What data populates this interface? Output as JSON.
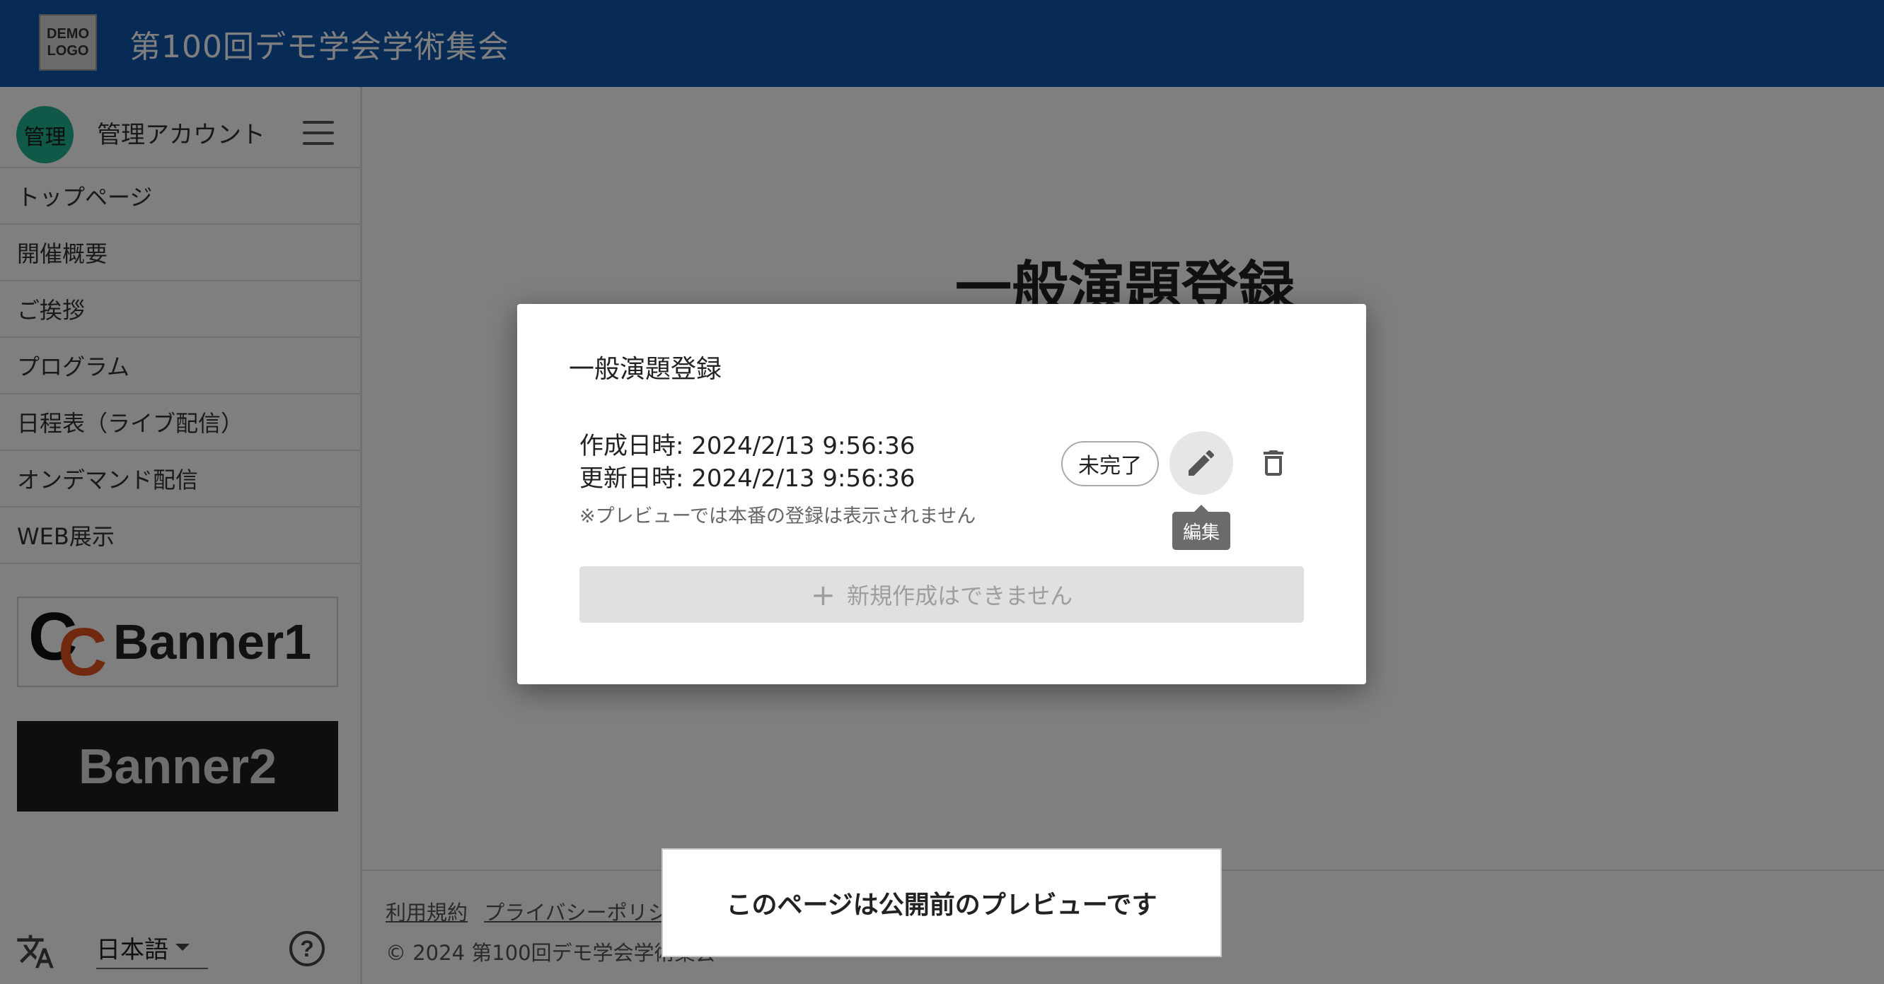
{
  "header": {
    "logo_text": "DEMO LOGO",
    "title": "第100回デモ学会学術集会"
  },
  "sidebar": {
    "account": {
      "avatar": "管理",
      "name": "管理アカウント"
    },
    "items": [
      {
        "label": "トップページ"
      },
      {
        "label": "開催概要"
      },
      {
        "label": "ご挨拶"
      },
      {
        "label": "プログラム"
      },
      {
        "label": "日程表（ライブ配信）"
      },
      {
        "label": "オンデマンド配信"
      },
      {
        "label": "WEB展示"
      }
    ],
    "banners": [
      {
        "label": "Banner1"
      },
      {
        "label": "Banner2"
      }
    ],
    "language": {
      "selected": "日本語"
    }
  },
  "main": {
    "heading": "一般演題登録",
    "footer": {
      "links": [
        "利用規約",
        "プライバシーポリシー"
      ],
      "copyright": "© 2024 第100回デモ学会学術集会"
    }
  },
  "dialog": {
    "title": "一般演題登録",
    "entry": {
      "created": "作成日時: 2024/2/13 9:56:36",
      "updated": "更新日時: 2024/2/13 9:56:36",
      "note": "※プレビューでは本番の登録は表示されません",
      "status": "未完了"
    },
    "tooltip": "編集",
    "new_button": "新規作成はできません"
  },
  "preview_notice": "このページは公開前のプレビューです",
  "colors": {
    "header_bg": "#0f57a8",
    "avatar_bg": "#20b08f",
    "banner1_accent": "#e0531f"
  }
}
